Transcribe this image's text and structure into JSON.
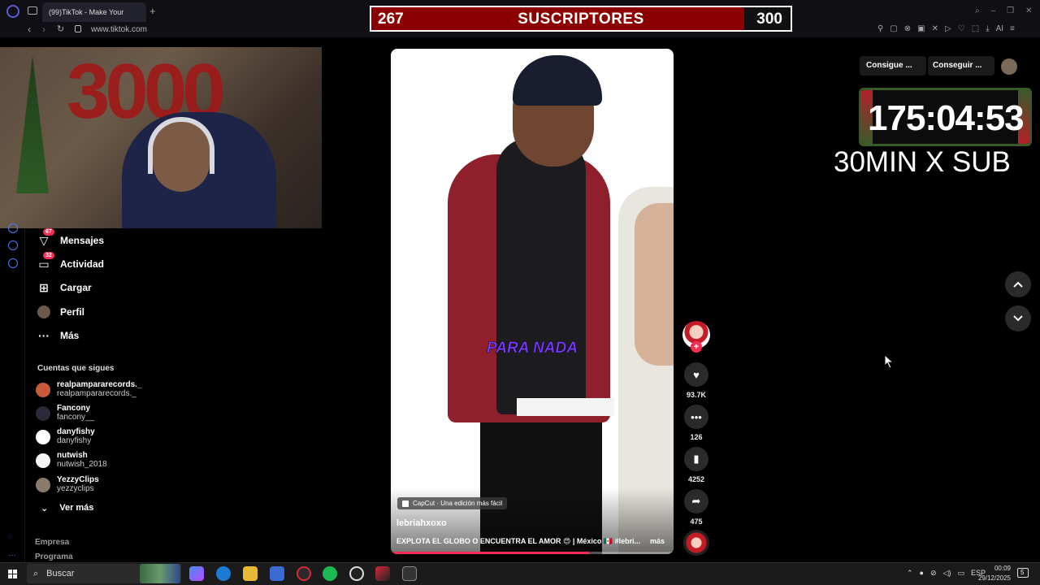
{
  "browser": {
    "tab_title": "(99)TikTok - Make Your",
    "url": "www.tiktok.com"
  },
  "subscriber_bar": {
    "current": "267",
    "label": "SUSCRIPTORES",
    "goal": "300",
    "progress": 0.89,
    "fill_color": "#8b0000"
  },
  "sidebar": {
    "nav_items": [
      {
        "label": "Mensajes",
        "badge": "67",
        "icon": "paper-plane-icon"
      },
      {
        "label": "Actividad",
        "badge": "32",
        "icon": "inbox-icon"
      },
      {
        "label": "Cargar",
        "icon": "upload-plus-icon"
      },
      {
        "label": "Perfil",
        "icon": "profile-avatar"
      },
      {
        "label": "Más",
        "icon": "more-dots-icon"
      }
    ],
    "following_title": "Cuentas que sigues",
    "following": [
      {
        "name": "realpampararecords._",
        "handle": "realpampararecords._"
      },
      {
        "name": "Fancony",
        "handle": "fancony__"
      },
      {
        "name": "danyfishy",
        "handle": "danyfishy"
      },
      {
        "name": "nutwish",
        "handle": "nutwish_2018"
      },
      {
        "name": "YezzyClips",
        "handle": "yezzyclips"
      }
    ],
    "see_more": "Ver más",
    "footer": [
      "Empresa",
      "Programa"
    ]
  },
  "video": {
    "overlay_caption": "PARA NADA",
    "capcut_label": "CapCut · Una edición más fácil",
    "author": "lebriahxoxo",
    "description": "EXPLOTA EL GLOBO O ENCUENTRA EL AMOR 😍 | México 🇲🇽 #lebri...",
    "more": "más",
    "progress": 0.7
  },
  "actions": {
    "likes": "93.7K",
    "comments": "126",
    "saves": "4252",
    "shares": "475"
  },
  "header_buttons": {
    "get_app": "Consigue ...",
    "get_coins": "Conseguir ..."
  },
  "stream_overlay": {
    "timer": "175:04:53",
    "rate": "30MIN X SUB"
  },
  "taskbar": {
    "search": "Buscar",
    "lang": "ESP",
    "time": "00:09",
    "date": "29/12/2025",
    "notifications": "5"
  },
  "colors": {
    "tiktok_red": "#fe2c55",
    "accent_blue": "#4a7cff"
  }
}
